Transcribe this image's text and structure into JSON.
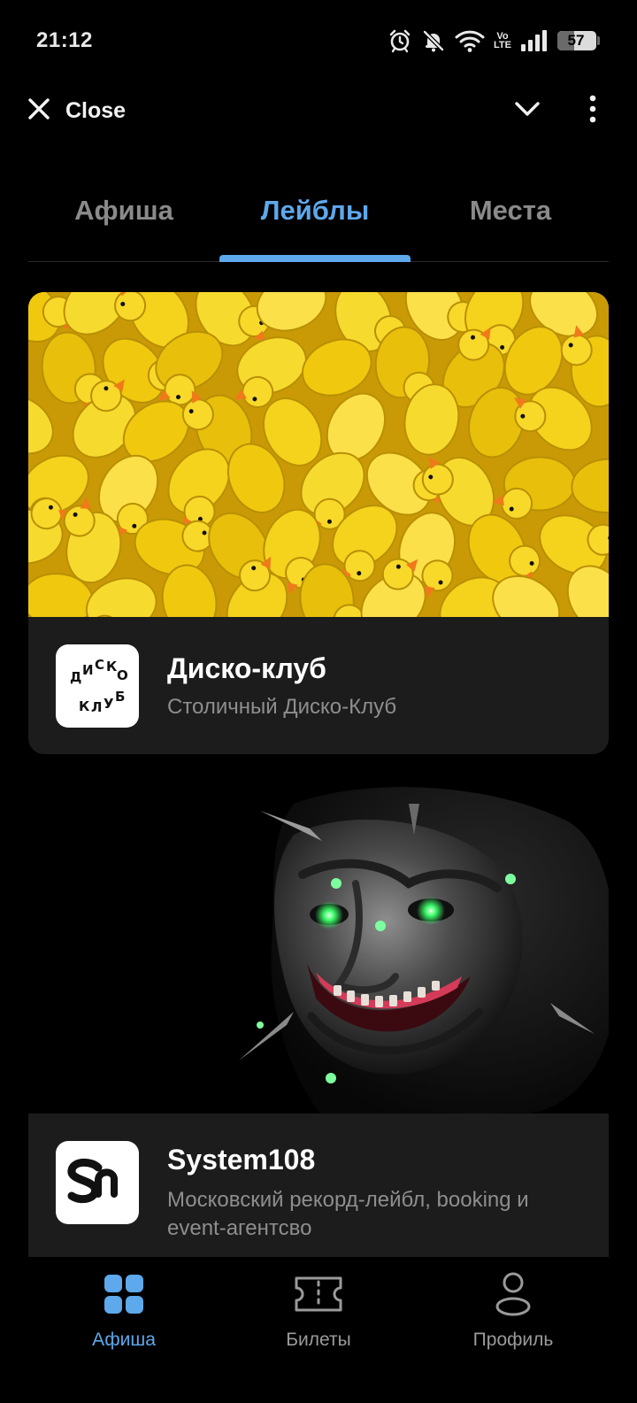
{
  "status_bar": {
    "time": "21:12",
    "network_label_top": "Vo",
    "network_label_bottom": "LTE",
    "battery_percent": "57",
    "icons": [
      "alarm-icon",
      "bell-muted-icon",
      "wifi-icon",
      "volte-icon",
      "signal-icon",
      "battery-icon"
    ]
  },
  "top_bar": {
    "close_label": "Close",
    "icons": [
      "close-icon",
      "chevron-down-icon",
      "more-vertical-icon"
    ]
  },
  "tabs": [
    {
      "label": "Афиша",
      "active": false
    },
    {
      "label": "Лейблы",
      "active": true
    },
    {
      "label": "Места",
      "active": false
    }
  ],
  "accent_color": "#5ea8ec",
  "cards": [
    {
      "title": "Диско-клуб",
      "subtitle": "Столичный Диско-Клуб",
      "logo_letters": [
        "Д",
        "И",
        "С",
        "К",
        "О",
        "К",
        "Л",
        "У",
        "Б"
      ],
      "image": "yellow rubber ducks"
    },
    {
      "title": "System108",
      "subtitle": "Московский рекорд-лейбл, booking и event-агентсво",
      "image": "grinning dark mask with glowing green eyes"
    }
  ],
  "bottom_nav": [
    {
      "label": "Афиша",
      "icon": "grid-icon",
      "active": true
    },
    {
      "label": "Билеты",
      "icon": "ticket-icon",
      "active": false
    },
    {
      "label": "Профиль",
      "icon": "profile-icon",
      "active": false
    }
  ]
}
